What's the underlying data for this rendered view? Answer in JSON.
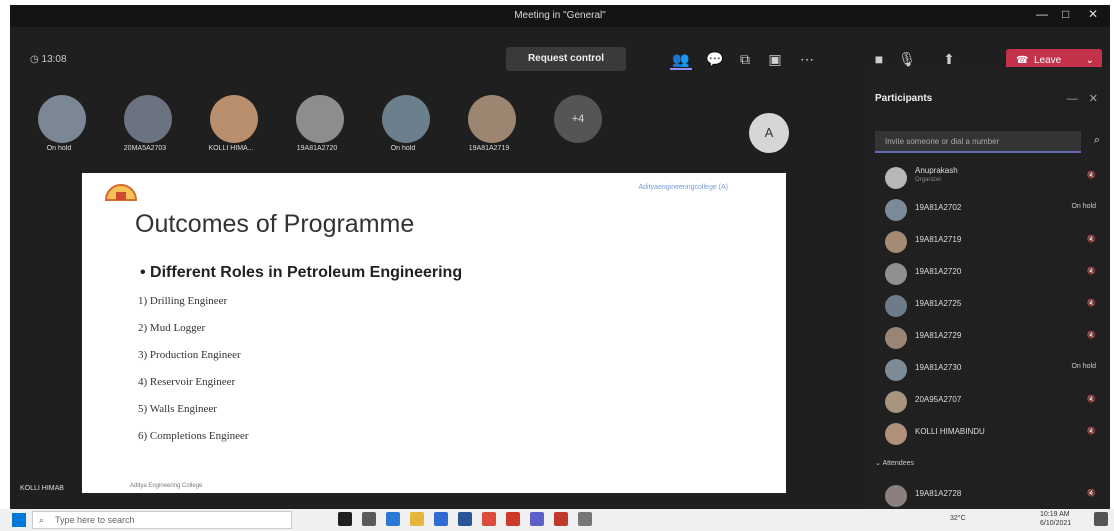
{
  "titlebar": {
    "title": "Meeting in \"General\""
  },
  "toolbar": {
    "timer": "13:08",
    "request_control": "Request control",
    "leave": "Leave"
  },
  "participants_strip": [
    {
      "name": "On hold"
    },
    {
      "name": "20MA5A2703"
    },
    {
      "name": "KOLLI HIMA..."
    },
    {
      "name": "19A81A2720"
    },
    {
      "name": "On hold"
    },
    {
      "name": "19A81A2719"
    },
    {
      "name": "+4"
    },
    {
      "name": "A"
    }
  ],
  "slide": {
    "top_right": "Adityaengineeringcollege (A)",
    "heading": "Outcomes of Programme",
    "bullet": "• Different Roles in Petroleum Engineering",
    "items": [
      "1)  Drilling Engineer",
      "2)  Mud Logger",
      "3)  Production Engineer",
      "4)  Reservoir Engineer",
      "5)  Walls Engineer",
      "6)  Completions Engineer"
    ],
    "footnote": "Aditya Engineering College"
  },
  "bottom_name": "KOLLI HIMAB",
  "panel": {
    "title": "Participants",
    "invite_placeholder": "Invite someone or dial a number",
    "attendees_label": "Attendees",
    "participants": [
      {
        "name": "Anuprakash",
        "role": "Organizer",
        "status": ""
      },
      {
        "name": "19A81A2702",
        "role": "",
        "status": "On hold"
      },
      {
        "name": "19A81A2719",
        "role": "",
        "status": ""
      },
      {
        "name": "19A81A2720",
        "role": "",
        "status": ""
      },
      {
        "name": "19A81A2725",
        "role": "",
        "status": ""
      },
      {
        "name": "19A81A2729",
        "role": "",
        "status": ""
      },
      {
        "name": "19A81A2730",
        "role": "",
        "status": "On hold"
      },
      {
        "name": "20A95A2707",
        "role": "",
        "status": ""
      },
      {
        "name": "KOLLI HIMABINDU",
        "role": "",
        "status": ""
      },
      {
        "name": "19A81A2728",
        "role": "",
        "status": ""
      }
    ]
  },
  "taskbar": {
    "search_placeholder": "Type here to search",
    "temp": "32°C",
    "time": "10:19 AM",
    "date": "6/10/2021"
  }
}
